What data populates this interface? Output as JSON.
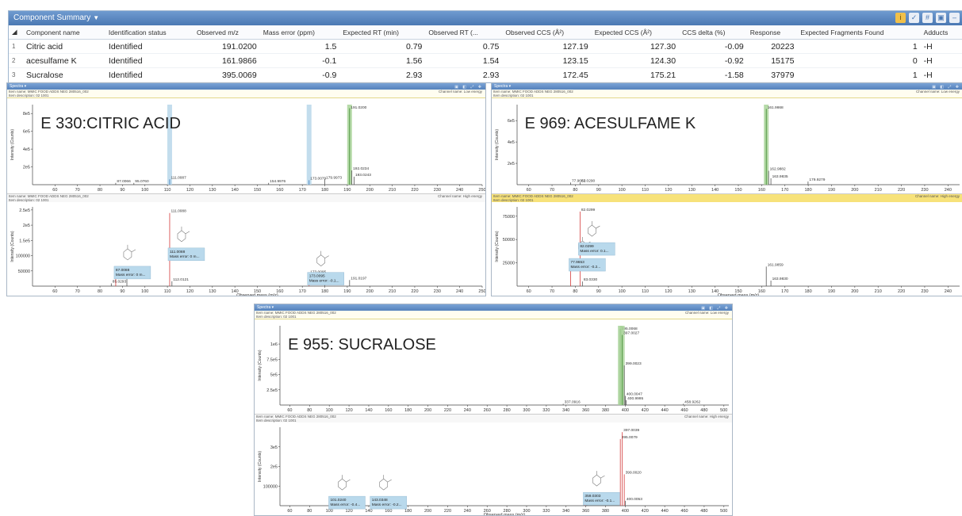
{
  "summary": {
    "title": "Component Summary",
    "columns": [
      "Component name",
      "Identification status",
      "Observed m/z",
      "Mass error (ppm)",
      "Expected RT (min)",
      "Observed RT (...",
      "Observed CCS (Å²)",
      "Expected CCS (Å²)",
      "CCS delta (%)",
      "Response",
      "Expected Fragments Found",
      "Adducts"
    ],
    "rows": [
      {
        "idx": "1",
        "name": "Citric acid",
        "status": "Identified",
        "mz": "191.0200",
        "err": "1.5",
        "ert": "0.79",
        "ort": "0.75",
        "occs": "127.19",
        "eccs": "127.30",
        "delta": "-0.09",
        "resp": "20223",
        "frag": "1",
        "adduct": "-H"
      },
      {
        "idx": "2",
        "name": "acesulfame K",
        "status": "Identified",
        "mz": "161.9866",
        "err": "-0.1",
        "ert": "1.56",
        "ort": "1.54",
        "occs": "123.15",
        "eccs": "124.30",
        "delta": "-0.92",
        "resp": "15175",
        "frag": "0",
        "adduct": "-H"
      },
      {
        "idx": "3",
        "name": "Sucralose",
        "status": "Identified",
        "mz": "395.0069",
        "err": "-0.9",
        "ert": "2.93",
        "ort": "2.93",
        "occs": "172.45",
        "eccs": "175.21",
        "delta": "-1.58",
        "resp": "37979",
        "frag": "1",
        "adduct": "-H"
      }
    ]
  },
  "common": {
    "ptitle": "Spectra ▾",
    "low_info": "Item name: MMIC FOOD ADDS NEG 280516_002",
    "desc": "Item description: 02 1001",
    "low_channel": "Channel name: Low energy",
    "high_channel": "Channel name: High energy",
    "xlabel": "Observed mass (m/z)",
    "ylabel": "Intensity (Counts)"
  },
  "panels": [
    {
      "id": "citric",
      "label": "E 330:CITRIC ACID",
      "top": {
        "ylim": [
          0,
          9
        ],
        "yticks": [
          "2e5",
          "4e5",
          "6e5",
          "8e5"
        ],
        "yvals": [
          2,
          4,
          6,
          8
        ],
        "peaks": [
          {
            "x": 87.0066,
            "y": 0.2,
            "label": "87.0066"
          },
          {
            "x": 95.076,
            "y": 0.2,
            "label": "95.0760"
          },
          {
            "x": 111.0087,
            "y": 0.6,
            "label": "111.0087",
            "hl": "blue"
          },
          {
            "x": 154.9976,
            "y": 0.2,
            "label": "154.9976"
          },
          {
            "x": 173.0079,
            "y": 0.5,
            "label": "173.0079",
            "hl": "blue"
          },
          {
            "x": 179.9973,
            "y": 0.6,
            "label": "179.9973"
          },
          {
            "x": 191.02,
            "y": 8.6,
            "label": "191.0200",
            "hl": "green"
          },
          {
            "x": 192.0234,
            "y": 1.6,
            "label": "192.0234"
          },
          {
            "x": 193.0243,
            "y": 0.9,
            "label": "193.0243"
          }
        ]
      },
      "bottom": {
        "ylim": [
          0,
          260000
        ],
        "yticks": [
          "50000",
          "100000",
          "1.5e5",
          "2e5",
          "2.5e5"
        ],
        "yvals": [
          50000,
          100000,
          150000,
          200000,
          250000
        ],
        "peaks": [
          {
            "x": 85.0293,
            "y": 9000,
            "label": "85.0293"
          },
          {
            "x": 87.0088,
            "y": 40000,
            "label": "87.0088",
            "color": "red"
          },
          {
            "x": 91.9761,
            "y": 27000,
            "label": "91.9761"
          },
          {
            "x": 111.0088,
            "y": 240000,
            "label": "111.0088",
            "color": "red"
          },
          {
            "x": 112.0121,
            "y": 16000,
            "label": "112.0121"
          },
          {
            "x": 173.0095,
            "y": 40000,
            "label": "173.0095",
            "color": "red"
          },
          {
            "x": 179.9969,
            "y": 6000,
            "label": "179.9969"
          },
          {
            "x": 191.0197,
            "y": 20000,
            "label": "191.0197"
          }
        ],
        "boxes": [
          {
            "x": 87.0088,
            "y": 60000,
            "l1": "87.0088",
            "l2": "Mass error: 0 m..."
          },
          {
            "x": 111.0088,
            "y": 120000,
            "l1": "111.0088",
            "l2": "Mass error: 0 m..."
          },
          {
            "x": 173.0095,
            "y": 40000,
            "l1": "173.0095",
            "l2": "Mass error: -0.1..."
          }
        ]
      },
      "xlim": [
        50,
        250
      ],
      "xticks": [
        "60",
        "70",
        "80",
        "90",
        "100",
        "110",
        "120",
        "130",
        "140",
        "150",
        "160",
        "170",
        "180",
        "190",
        "200",
        "210",
        "220",
        "230",
        "240",
        "250"
      ]
    },
    {
      "id": "acesulfame",
      "label": "E 969: ACESULFAME K",
      "top": {
        "ylim": [
          0,
          7.5
        ],
        "yticks": [
          "2e5",
          "4e5",
          "6e5"
        ],
        "yvals": [
          2,
          4,
          6
        ],
        "peaks": [
          {
            "x": 77.9653,
            "y": 0.2,
            "label": "77.9653"
          },
          {
            "x": 82.029,
            "y": 0.2,
            "label": "82.0290"
          },
          {
            "x": 161.9868,
            "y": 7.1,
            "label": "161.9868",
            "hl": "green"
          },
          {
            "x": 162.9882,
            "y": 1.3,
            "label": "162.9882"
          },
          {
            "x": 163.9835,
            "y": 0.6,
            "label": "163.9835"
          },
          {
            "x": 179.9279,
            "y": 0.3,
            "label": "179.9279"
          }
        ]
      },
      "bottom": {
        "ylim": [
          0,
          85000
        ],
        "yticks": [
          "25000",
          "50000",
          "75000"
        ],
        "yvals": [
          25000,
          50000,
          75000
        ],
        "peaks": [
          {
            "x": 77.9653,
            "y": 20000,
            "label": "77.9653",
            "color": "red"
          },
          {
            "x": 82.0299,
            "y": 80000,
            "label": "82.0299",
            "color": "red"
          },
          {
            "x": 83.033,
            "y": 5000,
            "label": "83.0330"
          },
          {
            "x": 161.9859,
            "y": 21000,
            "label": "161.9859"
          },
          {
            "x": 163.983,
            "y": 6000,
            "label": "163.9830"
          }
        ],
        "boxes": [
          {
            "x": 77.9653,
            "y": 28000,
            "l1": "77.9653",
            "l2": "Mass error: -0.2..."
          },
          {
            "x": 82.0299,
            "y": 45000,
            "l1": "82.0299",
            "l2": "Mass error: 0.1..."
          }
        ]
      },
      "xlim": [
        55,
        245
      ],
      "xticks": [
        "60",
        "70",
        "80",
        "90",
        "100",
        "110",
        "120",
        "130",
        "140",
        "150",
        "160",
        "170",
        "180",
        "190",
        "200",
        "210",
        "220",
        "230",
        "240"
      ]
    },
    {
      "id": "sucralose",
      "label": "E 955: SUCRALOSE",
      "top": {
        "ylim": [
          0,
          13
        ],
        "yticks": [
          "2.5e5",
          "5e5",
          "7.5e5",
          "1e6"
        ],
        "yvals": [
          2.5,
          5,
          7.5,
          10
        ],
        "peaks": [
          {
            "x": 337.0916,
            "y": 0.2,
            "label": "337.0916"
          },
          {
            "x": 395.0068,
            "y": 12.5,
            "label": "395.0068",
            "hl": "green"
          },
          {
            "x": 397.0027,
            "y": 11.5,
            "label": "397.0027",
            "hl": "green"
          },
          {
            "x": 399.0023,
            "y": 6.5,
            "label": "399.0023"
          },
          {
            "x": 400.0047,
            "y": 1.5,
            "label": "400.0047"
          },
          {
            "x": 400.9995,
            "y": 0.8,
            "label": "400.9995"
          },
          {
            "x": 458.9262,
            "y": 0.2,
            "label": "458.9262"
          }
        ]
      },
      "bottom": {
        "ylim": [
          0,
          400000
        ],
        "yticks": [
          "100000",
          "2e5",
          "3e5"
        ],
        "yvals": [
          100000,
          200000,
          300000
        ],
        "peaks": [
          {
            "x": 101.024,
            "y": 12000,
            "label": "101.0240",
            "color": "red"
          },
          {
            "x": 143.0348,
            "y": 12000,
            "label": "143.0348",
            "color": "red"
          },
          {
            "x": 359.0303,
            "y": 30000,
            "label": "359.0303",
            "color": "red"
          },
          {
            "x": 361.0275,
            "y": 15000,
            "label": "361.0275"
          },
          {
            "x": 395.0079,
            "y": 340000,
            "label": "395.0079",
            "color": "red"
          },
          {
            "x": 397.0039,
            "y": 375000,
            "label": "397.0039",
            "color": "red"
          },
          {
            "x": 399.002,
            "y": 160000,
            "label": "399.0020",
            "color": "red"
          },
          {
            "x": 400.0053,
            "y": 25000,
            "label": "400.0053"
          }
        ],
        "boxes": [
          {
            "x": 101.024,
            "y": 40000,
            "l1": "101.0240",
            "l2": "Mass error: -0.4..."
          },
          {
            "x": 143.0348,
            "y": 40000,
            "l1": "143.0348",
            "l2": "Mass error: -0.2..."
          },
          {
            "x": 359.0303,
            "y": 60000,
            "l1": "359.0303",
            "l2": "Mass error: -0.1..."
          }
        ]
      },
      "xlim": [
        50,
        505
      ],
      "xticks": [
        "60",
        "80",
        "100",
        "120",
        "140",
        "160",
        "180",
        "200",
        "220",
        "240",
        "260",
        "280",
        "300",
        "320",
        "340",
        "360",
        "380",
        "400",
        "420",
        "440",
        "460",
        "480",
        "500"
      ]
    }
  ]
}
